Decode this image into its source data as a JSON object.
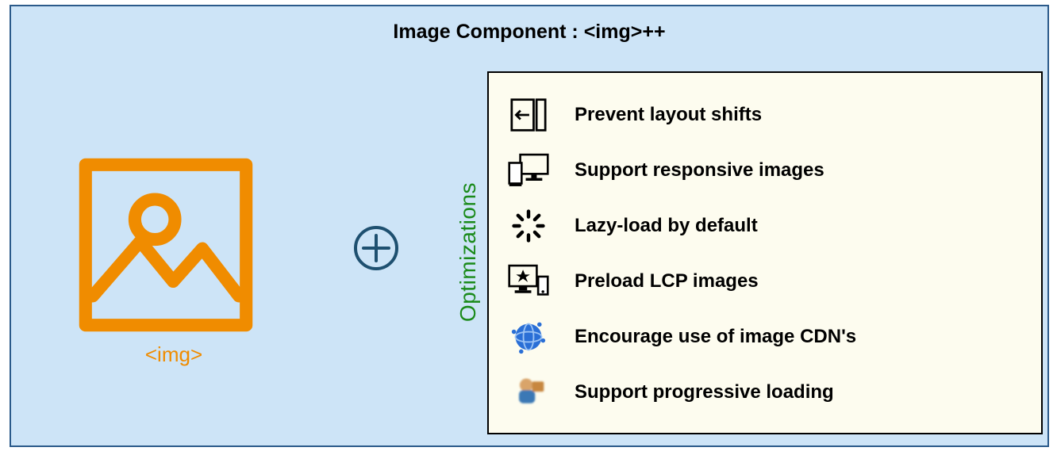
{
  "title": "Image Component : <img>++",
  "img_label": "<img>",
  "plus_symbol": "+",
  "opt_label": "Optimizations",
  "optimizations": [
    {
      "icon": "layout-shift-icon",
      "text": "Prevent layout shifts"
    },
    {
      "icon": "responsive-icon",
      "text": "Support responsive images"
    },
    {
      "icon": "lazy-icon",
      "text": "Lazy-load by default"
    },
    {
      "icon": "preload-icon",
      "text": "Preload LCP images"
    },
    {
      "icon": "cdn-icon",
      "text": "Encourage use of image CDN's"
    },
    {
      "icon": "progressive-icon",
      "text": "Support progressive loading"
    }
  ],
  "colors": {
    "bg": "#cde4f7",
    "border": "#2b5a8a",
    "accent": "#f08c00",
    "plus": "#1e5070",
    "opt_label": "#1a8a1a",
    "box_bg": "#fdfcef"
  }
}
